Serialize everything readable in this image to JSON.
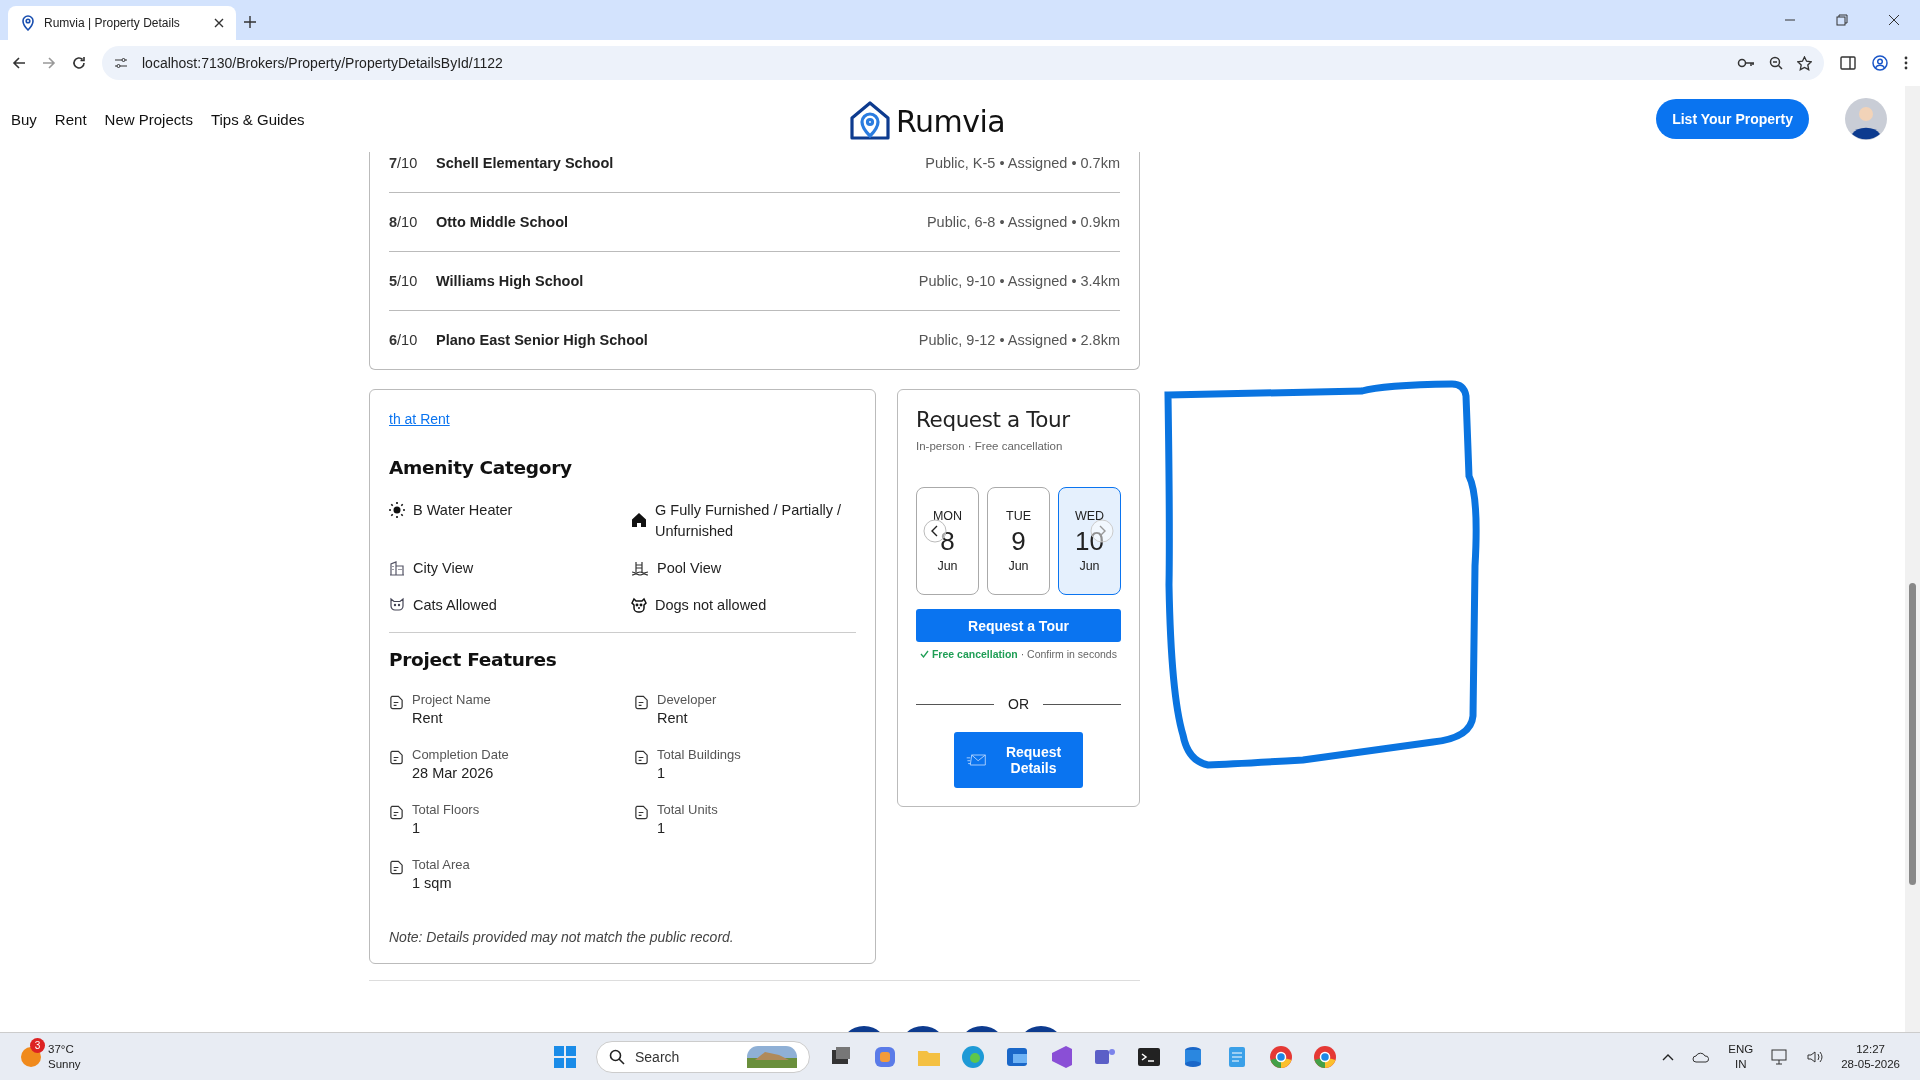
{
  "browser": {
    "tab_title": "Rumvia | Property Details",
    "url": "localhost:7130/Brokers/Property/PropertyDetailsById/1122"
  },
  "header": {
    "nav": [
      "Buy",
      "Rent",
      "New Projects",
      "Tips & Guides"
    ],
    "logo": "Rumvia",
    "cta": "List Your Property"
  },
  "schools": [
    {
      "rating": "**7**/10",
      "name": "Schell Elementary School",
      "details": "Public, K-5 • Assigned • 0.7km"
    },
    {
      "rating": "**8**/10",
      "name": "Otto Middle School",
      "details": "Public, 6-8 • Assigned • 0.9km"
    },
    {
      "rating": "**5**/10",
      "name": "Williams High School",
      "details": "Public, 9-10 • Assigned • 3.4km"
    },
    {
      "rating": "**6**/10",
      "name": "Plano East Senior High School",
      "details": "Public, 9-12 • Assigned • 2.8km"
    }
  ],
  "details": {
    "link": "th at Rent",
    "amenity_heading": "Amenity Category",
    "amenities": [
      {
        "kind": "sun",
        "label": "B Water Heater"
      },
      {
        "kind": "home",
        "label": "G Fully Furnished / Partially / Unfurnished"
      },
      {
        "kind": "city",
        "label": "City View"
      },
      {
        "kind": "pool",
        "label": "Pool View"
      },
      {
        "kind": "cat",
        "label": "Cats Allowed"
      },
      {
        "kind": "dog",
        "label": "Dogs not allowed"
      }
    ],
    "features_heading": "Project Features",
    "features": [
      {
        "label": "Project Name",
        "value": "Rent"
      },
      {
        "label": "Developer",
        "value": "Rent"
      },
      {
        "label": "Completion Date",
        "value": "28 Mar 2026"
      },
      {
        "label": "Total Buildings",
        "value": "1"
      },
      {
        "label": "Total Floors",
        "value": "1"
      },
      {
        "label": "Total Units",
        "value": "1"
      },
      {
        "label": "Total Area",
        "value": "1 sqm"
      }
    ],
    "note": "Note: Details provided may not match the public record."
  },
  "tour": {
    "title": "Request a Tour",
    "subtitle": "In-person · Free cancellation",
    "days": [
      {
        "weekday": "MON",
        "day": "8",
        "month": "Jun",
        "selected": false
      },
      {
        "weekday": "TUE",
        "day": "9",
        "month": "Jun",
        "selected": false
      },
      {
        "weekday": "WED",
        "day": "10",
        "month": "Jun",
        "selected": true
      }
    ],
    "button": "Request a Tour",
    "assurance_highlight": "Free cancellation",
    "assurance_rest": "· Confirm in seconds",
    "or": "OR",
    "details_button": "Request Details"
  },
  "taskbar": {
    "weather_badge": "3",
    "temperature": "37°C",
    "condition": "Sunny",
    "search_placeholder": "Search",
    "language": "ENG",
    "region": "IN",
    "time": "12:27",
    "date": "28-05-2026"
  }
}
